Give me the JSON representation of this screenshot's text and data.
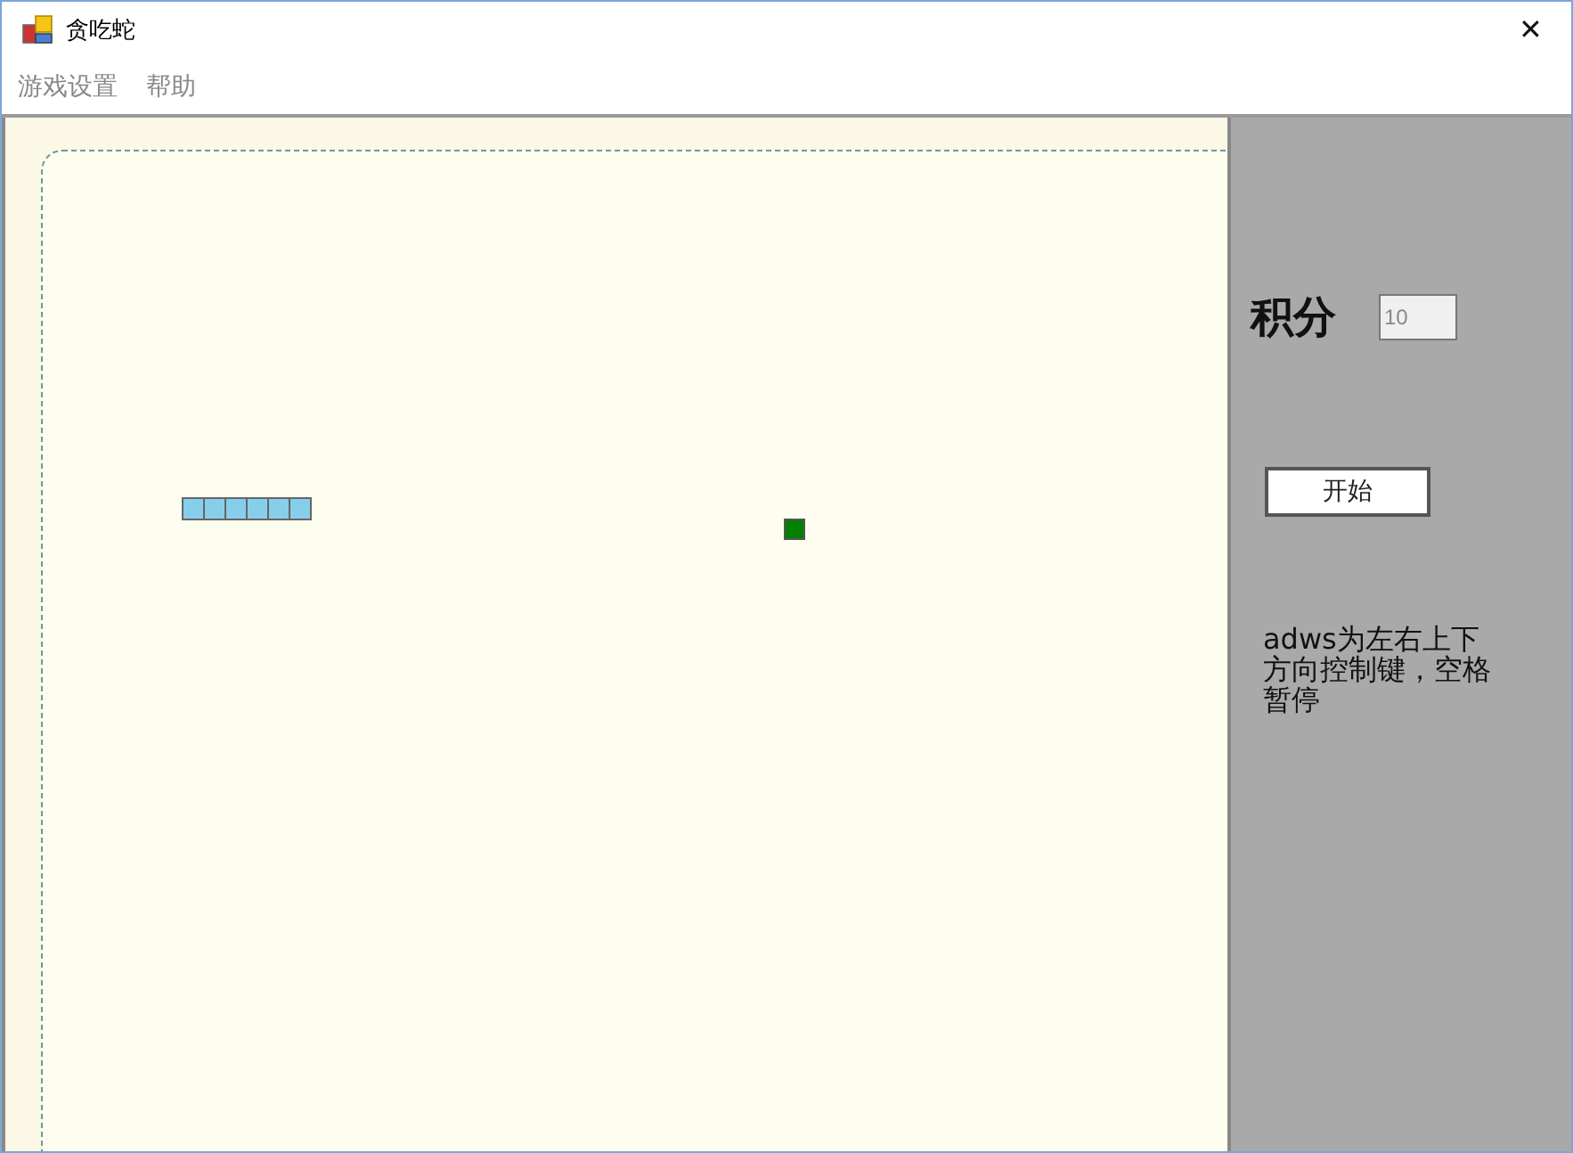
{
  "window": {
    "title": "贪吃蛇",
    "close": "✕"
  },
  "menu": [
    {
      "label": "游戏设置"
    },
    {
      "label": "帮助"
    }
  ],
  "panel": {
    "score_label": "积分",
    "score_value": "10",
    "start_button": "开始",
    "instructions": "adws为左右上下方向控制键，空格暂停"
  }
}
